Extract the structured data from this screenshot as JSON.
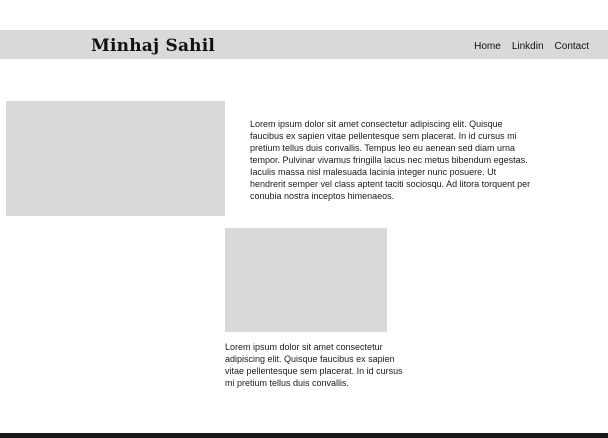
{
  "header": {
    "brand": "Minhaj Sahil",
    "nav": [
      {
        "label": "Home"
      },
      {
        "label": "Linkdin"
      },
      {
        "label": "Contact"
      }
    ]
  },
  "content": {
    "section_1": {
      "text": "Lorem ipsum dolor sit amet consectetur adipiscing elit. Quisque faucibus ex sapien vitae pellentesque sem placerat. In id cursus mi pretium tellus duis convallis. Tempus leo eu aenean sed diam urna tempor. Pulvinar vivamus fringilla lacus nec metus bibendum egestas. Iaculis massa nisl malesuada lacinia integer nunc posuere. Ut hendrerit semper vel class aptent taciti sociosqu. Ad litora torquent per conubia nostra inceptos himenaeos."
    },
    "section_2": {
      "text": "Lorem ipsum dolor sit amet consectetur adipiscing elit. Quisque faucibus ex sapien vitae pellentesque sem placerat. In id cursus mi pretium tellus duis convallis."
    }
  },
  "colors": {
    "header_bg": "#d9d9d9",
    "placeholder_bg": "#d9d9d9",
    "footer_bg": "#1a1a1a"
  }
}
